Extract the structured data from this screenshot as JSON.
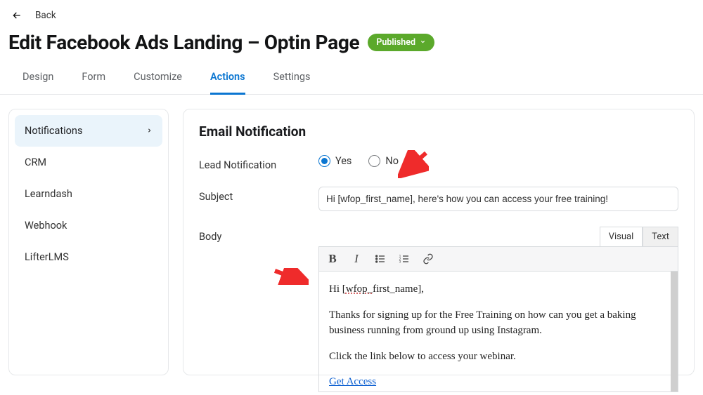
{
  "back_label": "Back",
  "title": "Edit Facebook Ads Landing – Optin Page",
  "status_badge": "Published",
  "tabs": [
    "Design",
    "Form",
    "Customize",
    "Actions",
    "Settings"
  ],
  "active_tab_index": 3,
  "sidebar": {
    "items": [
      "Notifications",
      "CRM",
      "Learndash",
      "Webhook",
      "LifterLMS"
    ],
    "active_index": 0
  },
  "section": {
    "heading": "Email Notification",
    "lead_label": "Lead Notification",
    "lead_yes": "Yes",
    "lead_no": "No",
    "subject_label": "Subject",
    "subject_value": "Hi [wfop_first_name], here's how you can access your free training!",
    "body_label": "Body",
    "editor_tabs": {
      "visual": "Visual",
      "text": "Text"
    },
    "body_line1_pre": "Hi [",
    "body_line1_token": "wfop_",
    "body_line1_post": "first_name],",
    "body_para1": "Thanks for signing up for the Free Training on how can you get a baking business running from ground up using Instagram.",
    "body_para2": "Click the link below to access your webinar.",
    "body_link": "Get Access"
  }
}
